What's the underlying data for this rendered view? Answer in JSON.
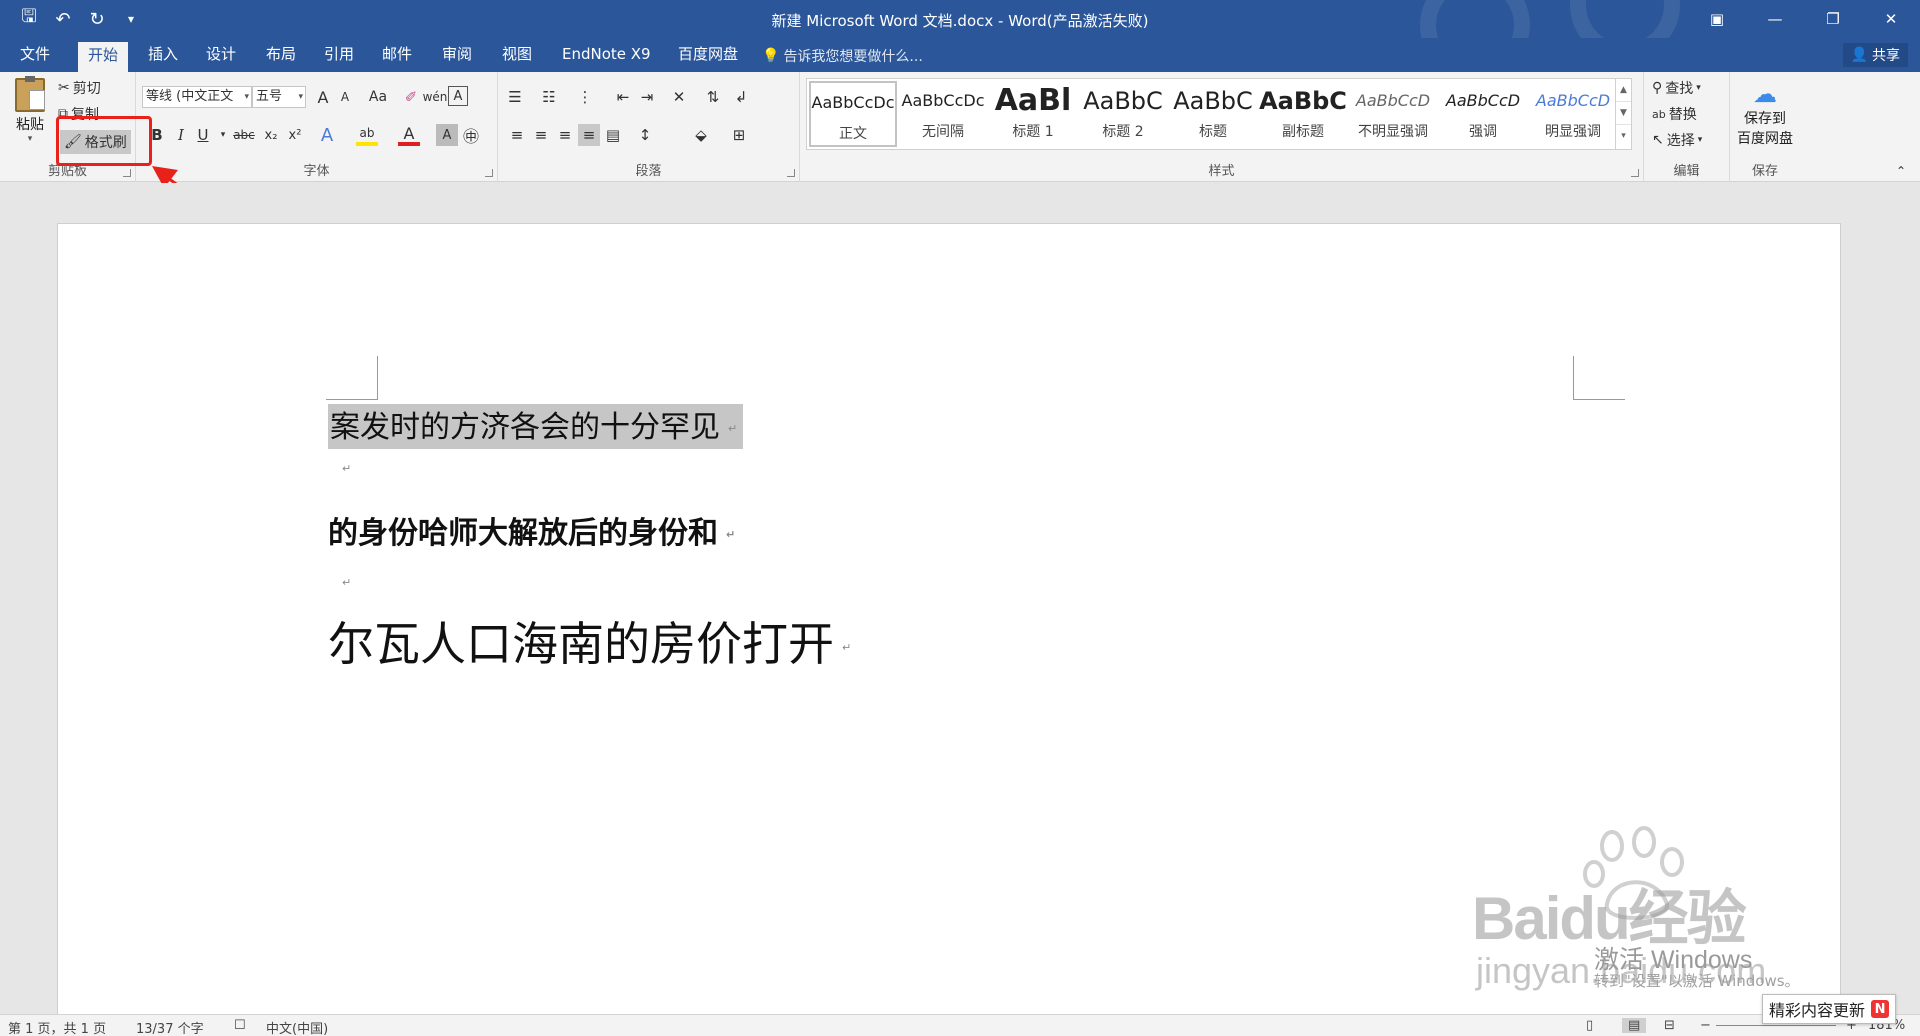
{
  "window": {
    "title": "新建 Microsoft Word 文档.docx - Word(产品激活失败)",
    "qat": {
      "save": "🖫",
      "undo": "↶",
      "redo": "↻",
      "customize": "▾"
    },
    "controls": {
      "restore_ribbon": "▣",
      "minimize": "—",
      "maximize": "❐",
      "close": "✕"
    }
  },
  "tabs": [
    "文件",
    "开始",
    "插入",
    "设计",
    "布局",
    "引用",
    "邮件",
    "审阅",
    "视图",
    "EndNote X9",
    "百度网盘"
  ],
  "active_tab": "开始",
  "tell_me": "告诉我您想要做什么...",
  "share": "共享",
  "clipboard": {
    "paste": "粘贴",
    "cut": "剪切",
    "copy": "复制",
    "format_painter": "格式刷",
    "label": "剪贴板"
  },
  "font": {
    "font_name": "等线 (中文正文",
    "font_size": "五号",
    "bold": "B",
    "italic": "I",
    "underline": "U",
    "strike": "abc",
    "sub": "x₂",
    "sup": "x²",
    "grow": "A",
    "shrink": "A",
    "case": "Aa",
    "label": "字体"
  },
  "paragraph": {
    "label": "段落"
  },
  "styles": {
    "label": "样式",
    "items": [
      {
        "preview": "AaBbCcDc",
        "name": "正文"
      },
      {
        "preview": "AaBbCcDc",
        "name": "无间隔"
      },
      {
        "preview": "AaBl",
        "name": "标题 1"
      },
      {
        "preview": "AaBbC",
        "name": "标题 2"
      },
      {
        "preview": "AaBbC",
        "name": "标题"
      },
      {
        "preview": "AaBbC",
        "name": "副标题"
      },
      {
        "preview": "AaBbCcD",
        "name": "不明显强调"
      },
      {
        "preview": "AaBbCcD",
        "name": "强调"
      },
      {
        "preview": "AaBbCcD",
        "name": "明显强调"
      }
    ]
  },
  "editing": {
    "find": "查找",
    "replace": "替换",
    "select": "选择",
    "label": "编辑"
  },
  "save_group": {
    "save_to_baidu_line1": "保存到",
    "save_to_baidu_line2": "百度网盘",
    "label": "保存"
  },
  "document": {
    "line1": "案发时的方济各会的十分罕见",
    "line2": "的身份哈师大解放后的身份和",
    "line3": "尔瓦人口海南的房价打开",
    "para_mark": "↵"
  },
  "status": {
    "page": "第 1 页，共 1 页",
    "words": "13/37 个字",
    "language": "中文(中国)",
    "zoom": "181%"
  },
  "watermarks": {
    "activate": "激活 Windows",
    "activate_sub": "转到\"设置\"以激活 Windows。",
    "baidu": "Baidu经验",
    "baidu_sub": "jingyan.baidu.com",
    "news": "精彩内容更新",
    "news_badge": "N"
  },
  "colors": {
    "ribbon_blue": "#2b579a",
    "highlight_red": "#e8221a",
    "selection_gray": "#c6c6c6"
  }
}
